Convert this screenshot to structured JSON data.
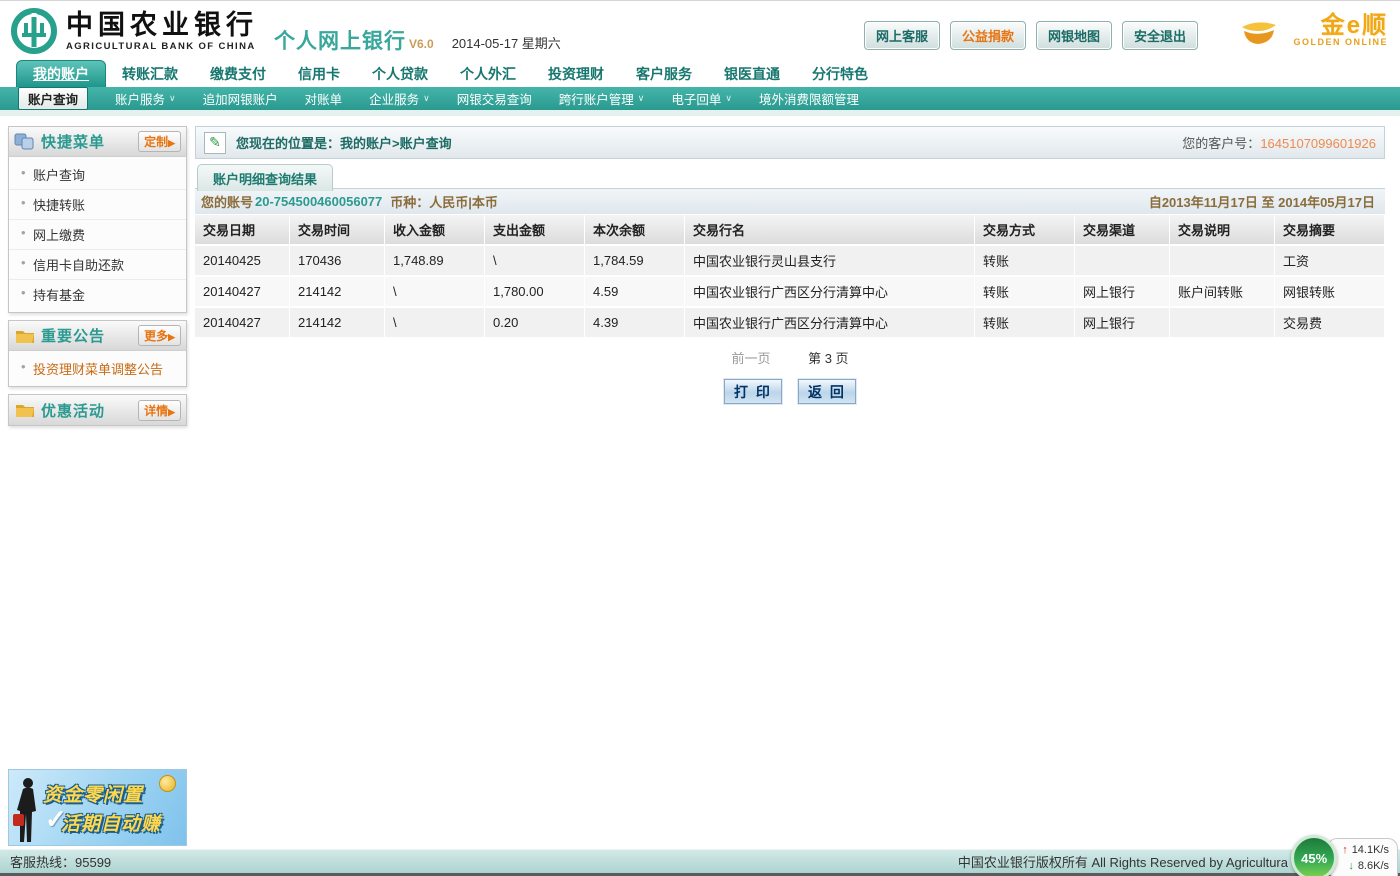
{
  "header": {
    "bank_name_cn": "中国农业银行",
    "bank_name_en": "AGRICULTURAL BANK OF CHINA",
    "product_title": "个人网上银行",
    "version": "V6.0",
    "date": "2014-05-17 星期六",
    "quick_links": [
      {
        "label": "网上客服",
        "highlight": false
      },
      {
        "label": "公益捐款",
        "highlight": true
      },
      {
        "label": "网银地图",
        "highlight": false
      },
      {
        "label": "安全退出",
        "highlight": false
      }
    ],
    "brand": {
      "cn": "金e顺",
      "en": "GOLDEN ONLINE"
    }
  },
  "main_nav": {
    "items": [
      {
        "label": "我的账户",
        "active": true
      },
      {
        "label": "转账汇款",
        "active": false
      },
      {
        "label": "缴费支付",
        "active": false
      },
      {
        "label": "信用卡",
        "active": false
      },
      {
        "label": "个人贷款",
        "active": false
      },
      {
        "label": "个人外汇",
        "active": false
      },
      {
        "label": "投资理财",
        "active": false
      },
      {
        "label": "客户服务",
        "active": false
      },
      {
        "label": "银医直通",
        "active": false
      },
      {
        "label": "分行特色",
        "active": false
      }
    ]
  },
  "sub_nav": {
    "items": [
      {
        "label": "账户查询",
        "active": true,
        "dropdown": false
      },
      {
        "label": "账户服务",
        "active": false,
        "dropdown": true
      },
      {
        "label": "追加网银账户",
        "active": false,
        "dropdown": false
      },
      {
        "label": "对账单",
        "active": false,
        "dropdown": false
      },
      {
        "label": "企业服务",
        "active": false,
        "dropdown": true
      },
      {
        "label": "网银交易查询",
        "active": false,
        "dropdown": false
      },
      {
        "label": "跨行账户管理",
        "active": false,
        "dropdown": true
      },
      {
        "label": "电子回单",
        "active": false,
        "dropdown": true
      },
      {
        "label": "境外消费限额管理",
        "active": false,
        "dropdown": false
      }
    ]
  },
  "sidebar": {
    "quick_menu": {
      "title": "快捷菜单",
      "action": "定制",
      "items": [
        "账户查询",
        "快捷转账",
        "网上缴费",
        "信用卡自助还款",
        "持有基金"
      ]
    },
    "notices": {
      "title": "重要公告",
      "action": "更多",
      "items": [
        "投资理财菜单调整公告"
      ]
    },
    "promotions": {
      "title": "优惠活动",
      "action": "详情"
    },
    "ad_banner": {
      "line1": "资金零闲置",
      "line2": "活期自动赚"
    }
  },
  "breadcrumb": {
    "location_text": "您现在的位置是：我的账户>账户查询",
    "customer_no_label": "您的客户号：",
    "customer_no": "1645107099601926"
  },
  "result_panel": {
    "tab_title": "账户明细查询结果",
    "account_label": "您的账号",
    "account_no": "20-754500460056077",
    "currency_text": "币种：人民币|本币",
    "date_range": "自2013年11月17日  至  2014年05月17日"
  },
  "table": {
    "headers": [
      "交易日期",
      "交易时间",
      "收入金额",
      "支出金额",
      "本次余额",
      "交易行名",
      "交易方式",
      "交易渠道",
      "交易说明",
      "交易摘要"
    ],
    "rows": [
      [
        "20140425",
        "170436",
        "1,748.89",
        "\\",
        "1,784.59",
        "中国农业银行灵山县支行",
        "转账",
        "",
        "",
        "工资"
      ],
      [
        "20140427",
        "214142",
        "\\",
        "1,780.00",
        "4.59",
        "中国农业银行广西区分行清算中心",
        "转账",
        "网上银行",
        "账户间转账",
        "网银转账"
      ],
      [
        "20140427",
        "214142",
        "\\",
        "0.20",
        "4.39",
        "中国农业银行广西区分行清算中心",
        "转账",
        "网上银行",
        "",
        "交易费"
      ]
    ]
  },
  "pagination": {
    "prev": "前一页",
    "current": "第 3 页"
  },
  "actions": {
    "print": "打 印",
    "back": "返 回"
  },
  "footer": {
    "hotline": "客服热线：95599",
    "copyright": "中国农业银行版权所有  All Rights Reserved by Agricultura",
    "net_widget": {
      "percent": "45%",
      "up_speed": "14.1K/s",
      "down_speed": "8.6K/s"
    }
  },
  "colors": {
    "brand_teal": "#2a9a90",
    "accent_orange": "#e87511",
    "gold": "#f0a818",
    "link_brown": "#8a6d3b"
  }
}
